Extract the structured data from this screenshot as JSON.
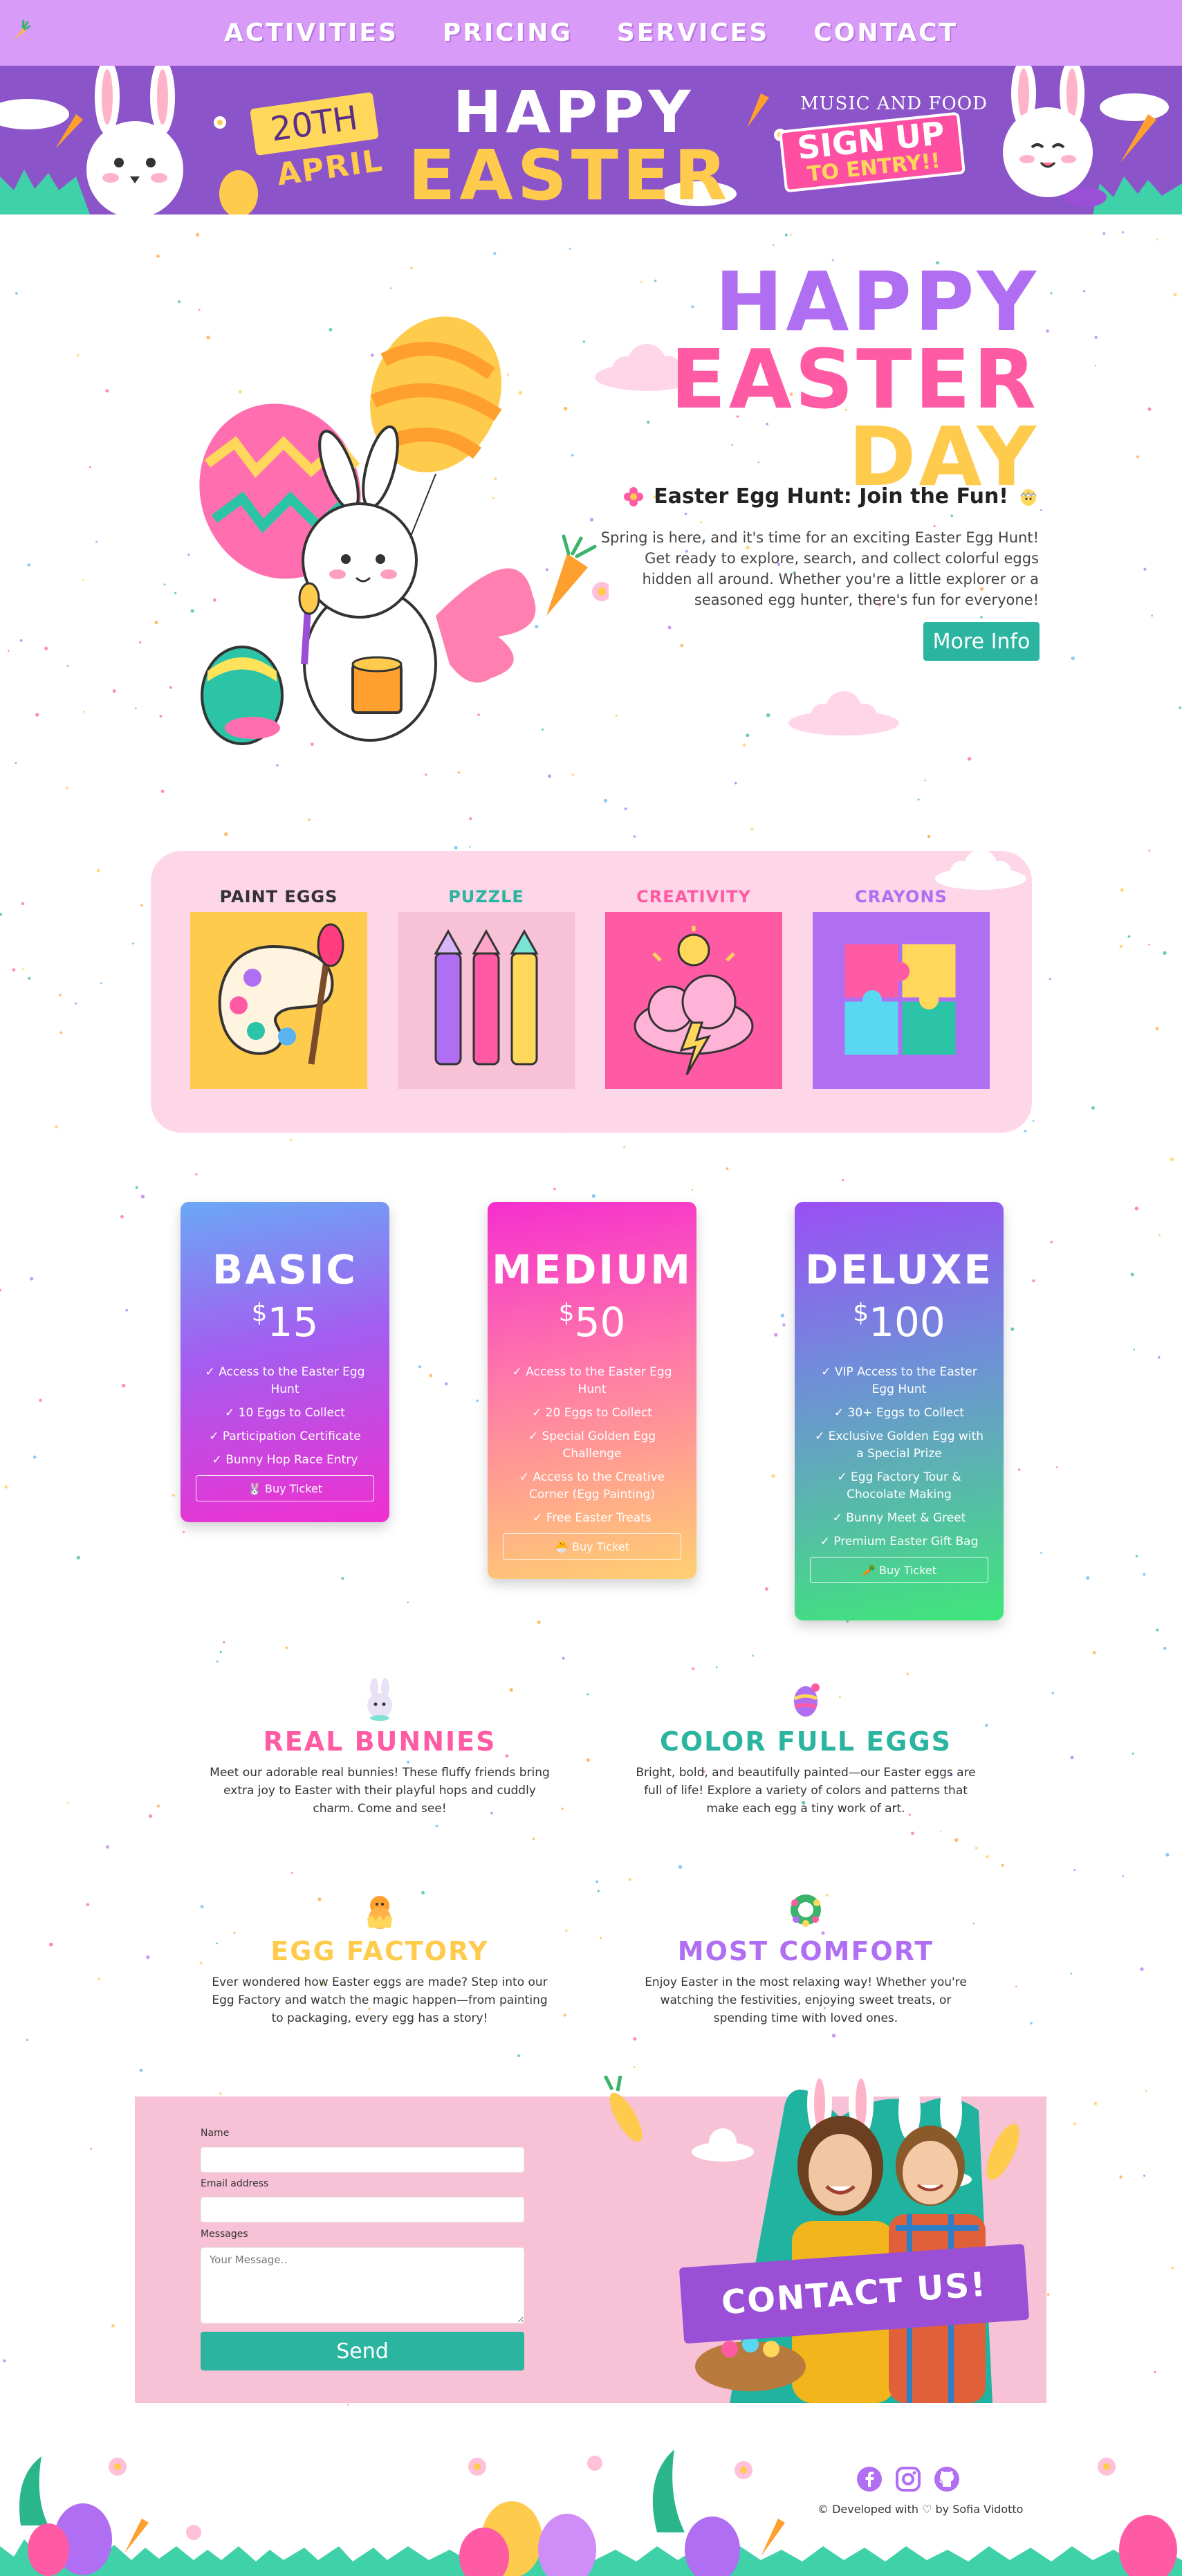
{
  "nav": {
    "items": [
      {
        "label": "ACTIVITIES"
      },
      {
        "label": "PRICING"
      },
      {
        "label": "SERVICES"
      },
      {
        "label": "CONTACT"
      }
    ]
  },
  "banner": {
    "date": "20TH",
    "month": "APRIL",
    "title_line1": "HAPPY",
    "title_line2": "EASTER",
    "tagline": "MUSIC AND FOOD",
    "signup_line1": "SIGN UP",
    "signup_line2": "TO ENTRY!!"
  },
  "hero": {
    "title_line1": "HAPPY",
    "title_line2": "EASTER",
    "title_line3": "DAY",
    "subtitle": "Easter Egg Hunt: Join the Fun!",
    "description": "Spring is here, and it's time for an exciting Easter Egg Hunt! Get ready to explore, search, and collect colorful eggs hidden all around. Whether you're a little explorer or a seasoned egg hunter, there's fun for everyone!",
    "button": "More Info"
  },
  "activities": [
    {
      "label": "PAINT EGGS",
      "color": "#333333"
    },
    {
      "label": "PUZZLE",
      "color": "#2bb5a0"
    },
    {
      "label": "CREATIVITY",
      "color": "#ff5aa4"
    },
    {
      "label": "CRAYONS",
      "color": "#b06ef2"
    }
  ],
  "pricing": [
    {
      "name": "BASIC",
      "currency": "$",
      "price": "15",
      "features": [
        "✓ Access to the Easter Egg Hunt",
        "✓ 10 Eggs to Collect",
        "✓ Participation Certificate",
        "✓ Bunny Hop Race Entry"
      ],
      "button": "🐰 Buy Ticket"
    },
    {
      "name": "MEDIUM",
      "currency": "$",
      "price": "50",
      "features": [
        "✓ Access to the Easter Egg Hunt",
        "✓ 20 Eggs to Collect",
        "✓ Special Golden Egg Challenge",
        "✓ Access to the Creative Corner (Egg Painting)",
        "✓ Free Easter Treats"
      ],
      "button": "🐣 Buy Ticket"
    },
    {
      "name": "DELUXE",
      "currency": "$",
      "price": "100",
      "features": [
        "✓ VIP Access to the Easter Egg Hunt",
        "✓ 30+ Eggs to Collect",
        "✓ Exclusive Golden Egg with a Special Prize",
        "✓ Egg Factory Tour & Chocolate Making",
        "✓ Bunny Meet & Greet",
        "✓ Premium Easter Gift Bag"
      ],
      "button": "🥕 Buy Ticket"
    }
  ],
  "features": [
    {
      "title": "REAL BUNNIES",
      "color": "#ff5aa4",
      "icon": "bunny-icon",
      "text": "Meet our adorable real bunnies! These fluffy friends bring extra joy to Easter with their playful hops and cuddly charm. Come and see!"
    },
    {
      "title": "COLOR FULL EGGS",
      "color": "#2bb5a0",
      "icon": "egg-icon",
      "text": "Bright, bold, and beautifully painted—our Easter eggs are full of life! Explore a variety of colors and patterns that make each egg a tiny work of art."
    },
    {
      "title": "EGG FACTORY",
      "color": "#ffcb4d",
      "icon": "chick-icon",
      "text": "Ever wondered how Easter eggs are made? Step into our Egg Factory and watch the magic happen—from painting to packaging, every egg has a story!"
    },
    {
      "title": "MOST COMFORT",
      "color": "#b06ef2",
      "icon": "wreath-icon",
      "text": "Enjoy Easter in the most relaxing way! Whether you're watching the festivities, enjoying sweet treats, or spending time with loved ones."
    }
  ],
  "contact": {
    "name_label": "Name",
    "email_label": "Email address",
    "message_label": "Messages",
    "message_placeholder": "Your Message..",
    "send_button": "Send",
    "banner": "CONTACT US!"
  },
  "footer": {
    "credit": "© Developed with ♡ by Sofia Vidotto",
    "social": [
      "facebook-icon",
      "instagram-icon",
      "github-icon"
    ]
  }
}
